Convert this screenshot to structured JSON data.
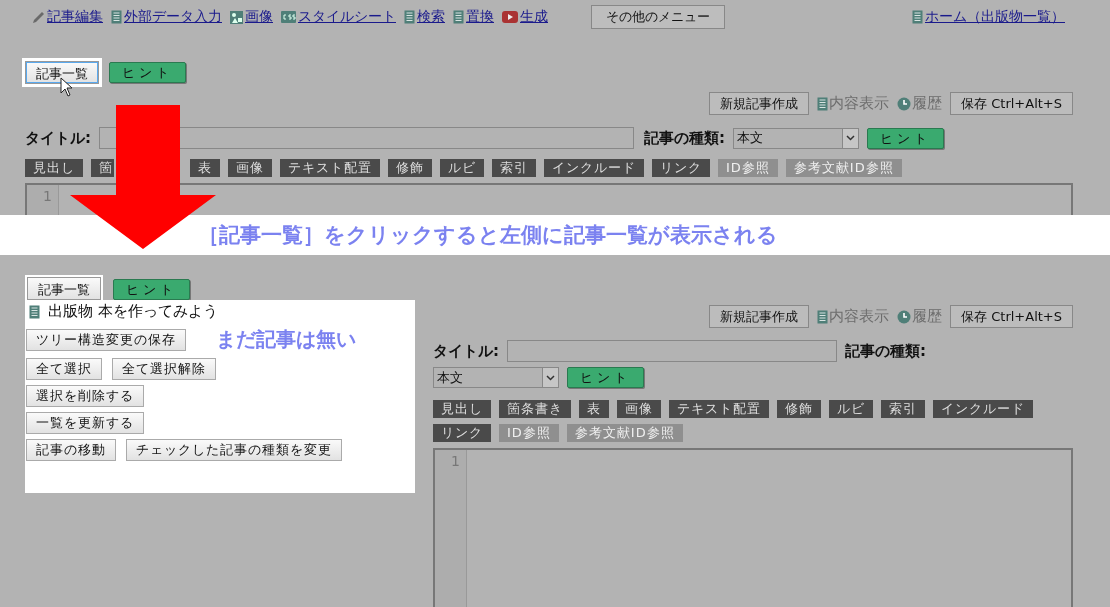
{
  "top_screen": {
    "nav": [
      {
        "label": "記事編集",
        "kind": "edit"
      },
      {
        "label": "外部データ入力",
        "kind": "doc"
      },
      {
        "label": "画像",
        "kind": "image"
      },
      {
        "label": "スタイルシート",
        "kind": "css"
      },
      {
        "label": "検索",
        "kind": "doc"
      },
      {
        "label": "置換",
        "kind": "doc"
      },
      {
        "label": "生成",
        "kind": "video"
      }
    ],
    "more_menu": "その他のメニュー",
    "home_link": "ホーム（出版物一覧）",
    "article_list_button": {
      "label": "記事一覧",
      "focused": true
    },
    "hint_button": "ヒント",
    "actions": {
      "new_article": "新規記事作成",
      "show_content": "内容表示",
      "history": "履歴",
      "save": "保存 Ctrl+Alt+S"
    },
    "title_label": "タイトル:",
    "article_type_label": "記事の種類:",
    "article_type_value": "本文",
    "type_hint_button": "ヒント",
    "tools": [
      {
        "label": "見出し",
        "disabled": false,
        "kind": "normal"
      },
      {
        "label": "箇",
        "disabled": false,
        "kind": "partial"
      },
      {
        "label": "表",
        "disabled": false,
        "kind": "normal"
      },
      {
        "label": "画像",
        "disabled": false,
        "kind": "normal"
      },
      {
        "label": "テキスト配置",
        "disabled": false,
        "kind": "normal"
      },
      {
        "label": "修飾",
        "disabled": false,
        "kind": "normal"
      },
      {
        "label": "ルビ",
        "disabled": false,
        "kind": "normal"
      },
      {
        "label": "索引",
        "disabled": false,
        "kind": "normal"
      },
      {
        "label": "インクルード",
        "disabled": false,
        "kind": "normal"
      },
      {
        "label": "リンク",
        "disabled": false,
        "kind": "normal"
      },
      {
        "label": "ID参照",
        "disabled": true,
        "kind": "normal"
      },
      {
        "label": "参考文献ID参照",
        "disabled": true,
        "kind": "normal"
      }
    ],
    "line_numbers": [
      "1"
    ]
  },
  "caption": "［記事一覧］をクリックすると左側に記事一覧が表示される",
  "bottom_screen": {
    "article_list_button": {
      "label": "記事一覧",
      "focused": false
    },
    "hint_button": "ヒント",
    "sidebar": {
      "tree_item": "出版物 本を作ってみよう",
      "note": "まだ記事は無い",
      "button_rows": [
        [
          "ツリー構造変更の保存"
        ],
        [
          "全て選択",
          "全て選択解除"
        ],
        [
          "選択を削除する"
        ],
        [
          "一覧を更新する"
        ],
        [
          "記事の移動",
          "チェックした記事の種類を変更"
        ]
      ]
    },
    "actions": {
      "new_article": "新規記事作成",
      "show_content": "内容表示",
      "history": "履歴",
      "save": "保存 Ctrl+Alt+S"
    },
    "title_label": "タイトル:",
    "article_type_label": "記事の種類:",
    "article_type_value": "本文",
    "type_hint_button": "ヒント",
    "tools": [
      {
        "label": "見出し",
        "disabled": false
      },
      {
        "label": "箇条書き",
        "disabled": false
      },
      {
        "label": "表",
        "disabled": false
      },
      {
        "label": "画像",
        "disabled": false
      },
      {
        "label": "テキスト配置",
        "disabled": false
      },
      {
        "label": "修飾",
        "disabled": false
      },
      {
        "label": "ルビ",
        "disabled": false
      },
      {
        "label": "索引",
        "disabled": false
      },
      {
        "label": "インクルード",
        "disabled": false
      },
      {
        "label": "リンク",
        "disabled": false
      },
      {
        "label": "ID参照",
        "disabled": true
      },
      {
        "label": "参考文献ID参照",
        "disabled": true
      }
    ],
    "line_numbers": [
      "1"
    ]
  }
}
